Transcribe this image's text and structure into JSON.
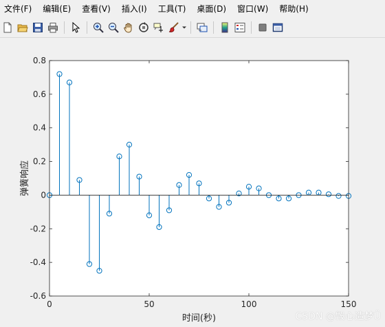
{
  "menu": {
    "file": "文件(F)",
    "edit": "编辑(E)",
    "view": "查看(V)",
    "insert": "插入(I)",
    "tools": "工具(T)",
    "desktop": "桌面(D)",
    "window": "窗口(W)",
    "help": "帮助(H)"
  },
  "toolbar": {
    "icons": [
      "new-file-icon",
      "open-folder-icon",
      "save-icon",
      "print-icon",
      "pointer-icon",
      "zoom-in-icon",
      "zoom-out-icon",
      "pan-icon",
      "rotate-3d-icon",
      "data-cursor-icon",
      "brush-icon",
      "link-plot-icon",
      "colorbar-icon",
      "legend-icon",
      "hide-plot-tools-icon",
      "show-plot-tools-icon"
    ]
  },
  "colors": {
    "stem": "#0072bd",
    "axes_bg": "#ffffff",
    "figure_bg": "#f0f0f0"
  },
  "watermark": "CSDN @毁心造梦Ü",
  "chart_data": {
    "type": "stem",
    "xlabel": "时间(秒)",
    "ylabel": "弹簧响应",
    "xlim": [
      0,
      150
    ],
    "ylim": [
      -0.6,
      0.8
    ],
    "xticks": [
      0,
      50,
      100,
      150
    ],
    "xtick_labels": [
      "0",
      "50",
      "100",
      "150"
    ],
    "yticks": [
      -0.6,
      -0.4,
      -0.2,
      0,
      0.2,
      0.4,
      0.6,
      0.8
    ],
    "ytick_labels": [
      "-0.6",
      "-0.4",
      "-0.2",
      "0",
      "0.2",
      "0.4",
      "0.6",
      "0.8"
    ],
    "x": [
      0,
      5,
      10,
      15,
      20,
      25,
      30,
      35,
      40,
      45,
      50,
      55,
      60,
      65,
      70,
      75,
      80,
      85,
      90,
      95,
      100,
      105,
      110,
      115,
      120,
      125,
      130,
      135,
      140,
      145,
      150
    ],
    "y": [
      0,
      0.72,
      0.67,
      0.09,
      -0.41,
      -0.45,
      -0.11,
      0.23,
      0.3,
      0.11,
      -0.12,
      -0.19,
      -0.09,
      0.06,
      0.12,
      0.07,
      -0.02,
      -0.07,
      -0.045,
      0.01,
      0.05,
      0.04,
      0.0,
      -0.02,
      -0.02,
      0.0,
      0.015,
      0.015,
      0.005,
      -0.005,
      -0.005
    ]
  }
}
